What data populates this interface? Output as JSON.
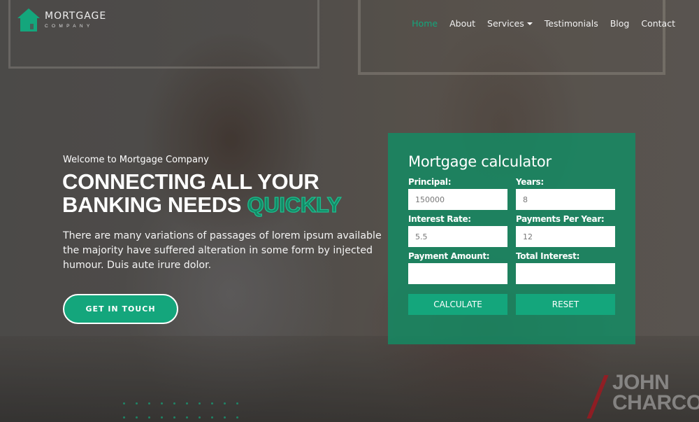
{
  "brand": {
    "title": "MORTGAGE",
    "subtitle": "COMPANY",
    "accent_color": "#14a67c"
  },
  "nav": {
    "items": [
      {
        "label": "Home",
        "active": true
      },
      {
        "label": "About"
      },
      {
        "label": "Services",
        "has_dropdown": true
      },
      {
        "label": "Testimonials"
      },
      {
        "label": "Blog"
      },
      {
        "label": "Contact"
      }
    ]
  },
  "hero": {
    "welcome": "Welcome to Mortgage Company",
    "headline_line1": "CONNECTING ALL YOUR",
    "headline_line2": "BANKING NEEDS",
    "headline_accent": "QUICKLY",
    "description": "There are many variations of passages of lorem ipsum available the majority have suffered alteration in some form by injected humour. Duis aute irure dolor.",
    "cta_label": "GET IN TOUCH"
  },
  "calculator": {
    "title": "Mortgage calculator",
    "fields": {
      "principal": {
        "label": "Principal:",
        "value": "150000"
      },
      "years": {
        "label": "Years:",
        "value": "8"
      },
      "interest_rate": {
        "label": "Interest Rate:",
        "value": "5.5"
      },
      "payments_per_year": {
        "label": "Payments Per Year:",
        "value": "12"
      },
      "payment_amount": {
        "label": "Payment Amount:",
        "value": ""
      },
      "total_interest": {
        "label": "Total Interest:",
        "value": ""
      }
    },
    "calculate_label": "CALCULATE",
    "reset_label": "RESET"
  },
  "watermark": {
    "line1": "JOHN",
    "line2": "CHARCO"
  }
}
